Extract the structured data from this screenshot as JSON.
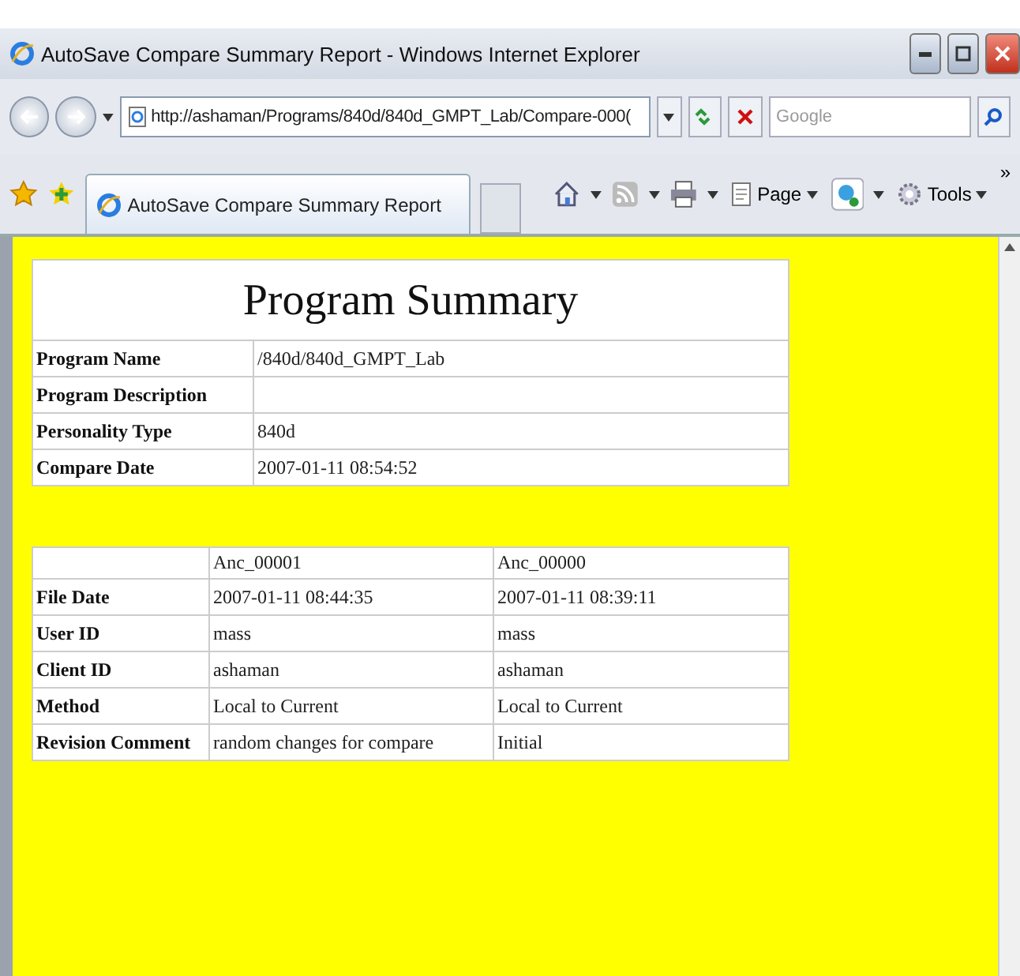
{
  "window": {
    "title": "AutoSave Compare Summary Report - Windows Internet Explorer"
  },
  "address_bar": {
    "url": "http://ashaman/Programs/840d/840d_GMPT_Lab/Compare-000("
  },
  "search": {
    "placeholder": "Google"
  },
  "tabs": [
    {
      "label": "AutoSave Compare Summary Report",
      "selected": true
    }
  ],
  "command_bar": {
    "menus": [
      "Page",
      "Tools"
    ],
    "overflow": "»"
  },
  "summary": {
    "title": "Program Summary",
    "rows": [
      {
        "label": "Program Name",
        "value": "/840d/840d_GMPT_Lab"
      },
      {
        "label": "Program Description"
      },
      {
        "label": "Personality Type",
        "value": "840d"
      },
      {
        "label": "Compare Date",
        "value": "2007-01-11 08:54:52"
      }
    ]
  },
  "comparison": {
    "columns": [
      "Anc_00001",
      "Anc_00000"
    ],
    "rows": [
      {
        "label": "File Date",
        "values": [
          "2007-01-11 08:44:35",
          "2007-01-11 08:39:11"
        ]
      },
      {
        "label": "User ID",
        "values": [
          "mass",
          "mass"
        ]
      },
      {
        "label": "Client ID",
        "values": [
          "ashaman",
          "ashaman"
        ]
      },
      {
        "label": "Method",
        "values": [
          "Local to Current",
          "Local to Current"
        ]
      },
      {
        "label": "Revision Comment",
        "values": [
          "random changes for compare",
          "Initial"
        ]
      }
    ]
  }
}
